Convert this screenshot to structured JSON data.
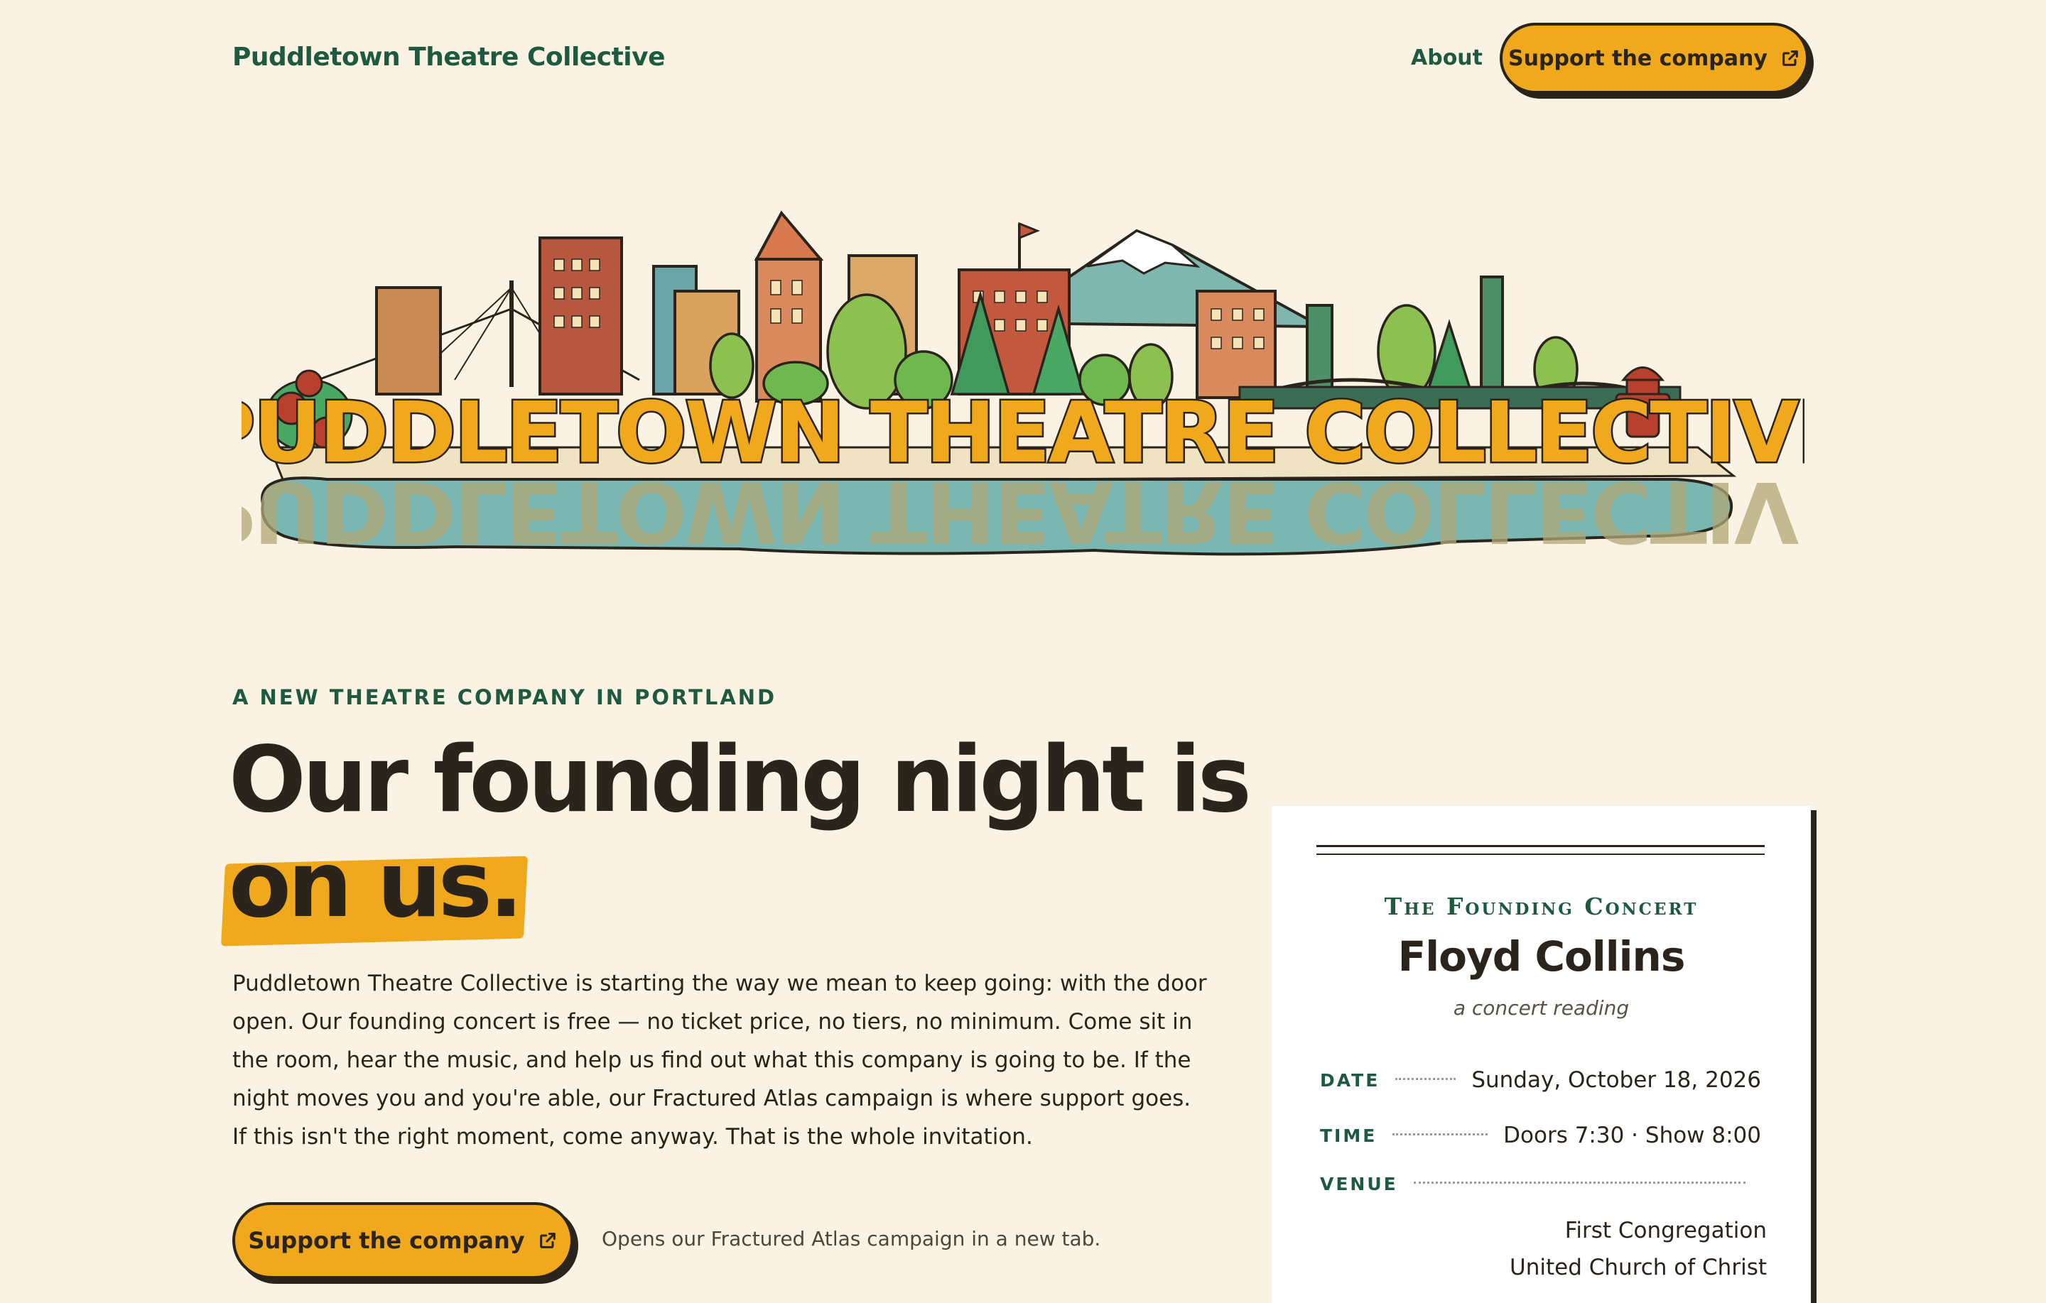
{
  "header": {
    "brand": "Puddletown Theatre Collective",
    "nav_about": "About",
    "support_label": "Support the company",
    "support_icon": "external-link-icon"
  },
  "hero": {
    "wordmark": "PUDDLETOWN THEATRE COLLECTIVE"
  },
  "intro": {
    "eyebrow": "A NEW THEATRE COMPANY IN PORTLAND",
    "headline_line1": "Our founding night is",
    "headline_line2": "on us.",
    "lede": "Puddletown Theatre Collective is starting the way we mean to keep going: with the door open. Our founding concert is free — no ticket price, no tiers, no minimum. Come sit in the room, hear the music, and help us find out what this company is going to be. If the night moves you and you're able, our Fractured Atlas campaign is where support goes. If this isn't the right moment, come anyway. That is the whole invitation.",
    "cta_label": "Support the company",
    "cta_note": "Opens our Fractured Atlas campaign in a new tab."
  },
  "card": {
    "kicker": "The Founding Concert",
    "title": "Floyd Collins",
    "subtitle": "a concert reading",
    "date_label": "DATE",
    "date_value": "Sunday, October 18, 2026",
    "time_label": "TIME",
    "time_value": "Doors 7:30 · Show 8:00",
    "venue_label": "VENUE",
    "venue_line1": "First Congregation",
    "venue_line2": "United Church of Christ"
  },
  "colors": {
    "background": "#faf3e3",
    "brand_green": "#1f5a40",
    "accent_gold": "#f0a81c",
    "ink": "#2a241d",
    "water": "#6fb0ae"
  }
}
